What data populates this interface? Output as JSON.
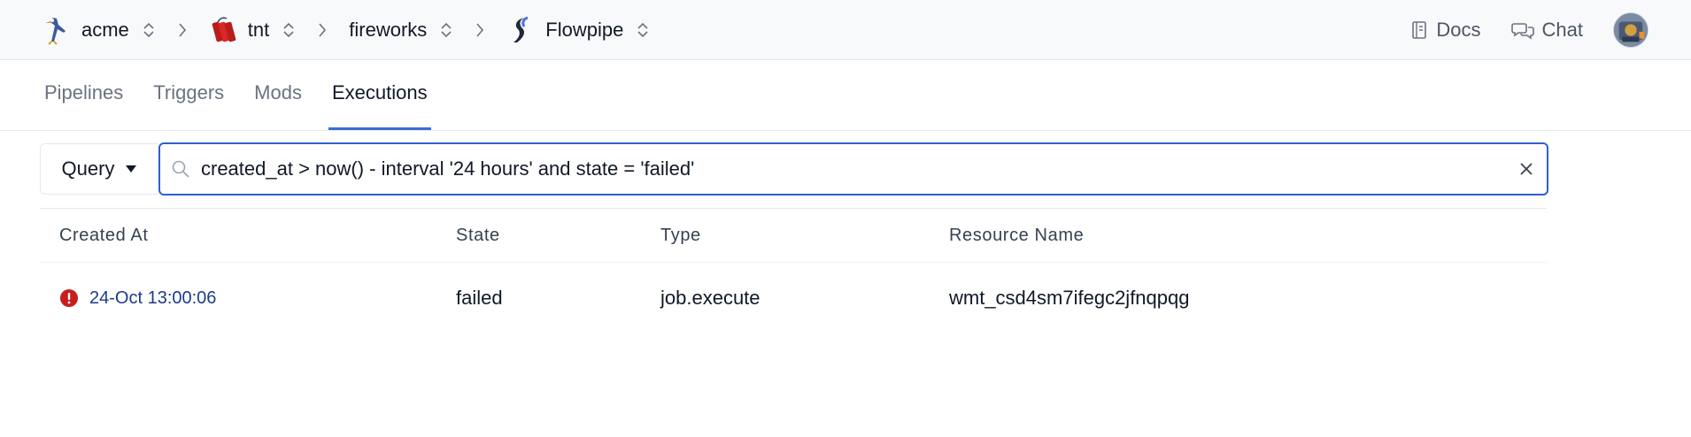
{
  "breadcrumb": {
    "items": [
      {
        "label": "acme",
        "icon": "roadrunner-icon"
      },
      {
        "label": "tnt",
        "icon": "dynamite-icon"
      },
      {
        "label": "fireworks",
        "icon": ""
      },
      {
        "label": "Flowpipe",
        "icon": "flowpipe-logo-icon"
      }
    ]
  },
  "topbar": {
    "docs_label": "Docs",
    "chat_label": "Chat"
  },
  "tabs": [
    {
      "label": "Pipelines",
      "active": false
    },
    {
      "label": "Triggers",
      "active": false
    },
    {
      "label": "Mods",
      "active": false
    },
    {
      "label": "Executions",
      "active": true
    }
  ],
  "query": {
    "mode_label": "Query",
    "value": "created_at > now() - interval '24 hours' and state = 'failed'"
  },
  "table": {
    "headers": [
      "Created At",
      "State",
      "Type",
      "Resource Name"
    ],
    "rows": [
      {
        "created_at": "24-Oct 13:00:06",
        "state": "failed",
        "type": "job.execute",
        "resource_name": "wmt_csd4sm7ifegc2jfnqpqg"
      }
    ]
  },
  "colors": {
    "accent": "#2f5fd0",
    "link": "#1e3a8a",
    "error": "#c81e1e"
  }
}
